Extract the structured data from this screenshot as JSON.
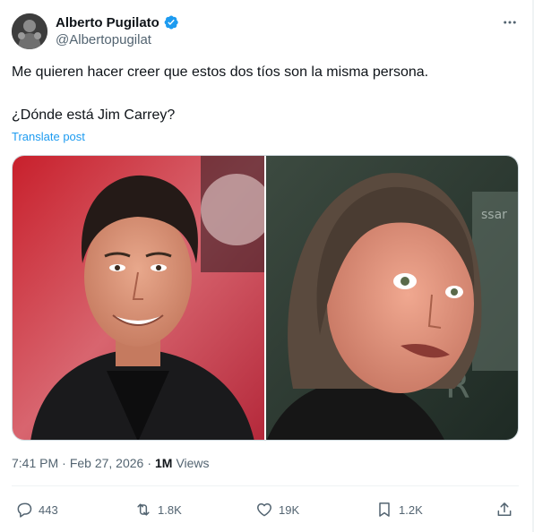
{
  "author": {
    "display_name": "Alberto Pugilato",
    "handle": "@Albertopugilat",
    "verified": true
  },
  "tweet": {
    "line1": "Me quieren hacer creer que estos dos tíos son la misma persona.",
    "line2": "¿Dónde está Jim Carrey?",
    "translate_label": "Translate post"
  },
  "media": {
    "count": 2
  },
  "meta": {
    "time": "7:41 PM",
    "separator": "·",
    "date": "Feb 27, 2026",
    "views_count": "1M",
    "views_label": "Views"
  },
  "actions": {
    "replies": "443",
    "reposts": "1.8K",
    "likes": "19K",
    "bookmarks": "1.2K"
  },
  "colors": {
    "accent": "#1d9bf0",
    "secondary_text": "#536471",
    "primary_text": "#0f1419"
  },
  "icons": [
    "verified-badge-icon",
    "more-icon",
    "reply-icon",
    "repost-icon",
    "like-icon",
    "bookmark-icon",
    "share-icon"
  ]
}
